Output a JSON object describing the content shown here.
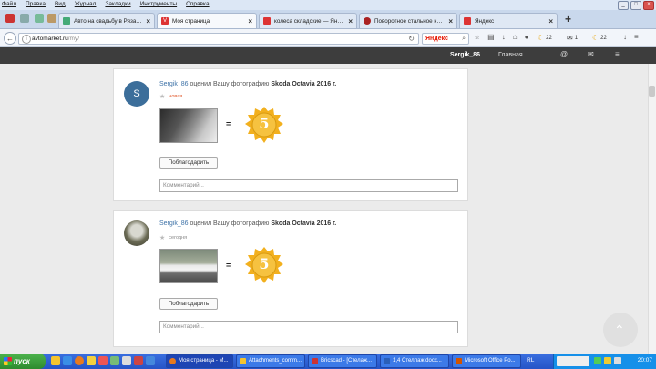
{
  "menu": {
    "items": [
      "Файл",
      "Правка",
      "Вид",
      "Журнал",
      "Закладки",
      "Инструменты",
      "Справка"
    ]
  },
  "tabs": [
    {
      "title": "Авто на свадьбу в Рязан...",
      "active": false
    },
    {
      "title": "Моя страница",
      "active": true
    },
    {
      "title": "колеса складские — Яндекс...",
      "active": false
    },
    {
      "title": "Поворотное стальное колес...",
      "active": false
    },
    {
      "title": "Яндекс",
      "active": false
    }
  ],
  "nav": {
    "url_host": "avtomarket.ru",
    "url_path": "/my/",
    "search_label": "Яндекс",
    "badge_weather1": "22",
    "badge_mail": "1",
    "badge_weather2": "22"
  },
  "site_header": {
    "username": "Sergik_86",
    "main_link": "Главная"
  },
  "cards": [
    {
      "username": "Sergik_86",
      "action": "оценил Вашу фотографию",
      "subject": "Skoda Octavia 2016 г.",
      "status": "новая",
      "rating": "5",
      "equals": "=",
      "thanks_label": "Поблагодарить",
      "comment_placeholder": "Комментарий..."
    },
    {
      "username": "Sergik_86",
      "action": "оценил Вашу фотографию",
      "subject": "Skoda Octavia 2016 г.",
      "status": "сегодня",
      "rating": "5",
      "equals": "=",
      "thanks_label": "Поблагодарить",
      "comment_placeholder": "Комментарий..."
    }
  ],
  "taskbar": {
    "start_label": "пуск",
    "tasks": [
      "Моя страница - М...",
      "Attachments_comm...",
      "Bricscad - [Стелаж...",
      "1,4 Стеллаж.docx...",
      "Microsoft Office Po..."
    ],
    "lang": "RL",
    "clock": "20:07"
  },
  "colors": {
    "accent_link": "#3f73a8",
    "header_bg": "#3d3d3d",
    "medal_gold": "#f2b01e",
    "status_new": "#e25b2e"
  }
}
